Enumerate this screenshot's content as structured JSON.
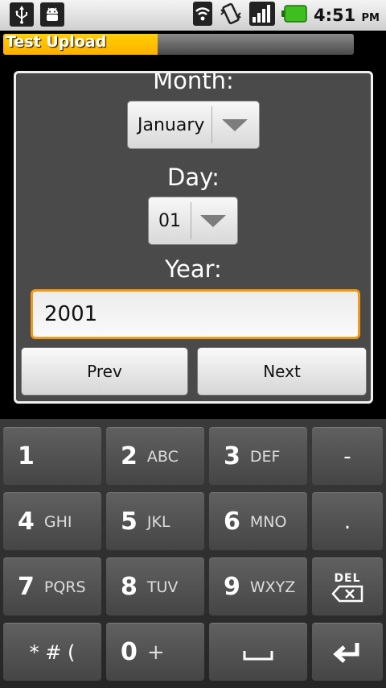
{
  "status_bar": {
    "icons": [
      "usb-icon",
      "android-debug-icon",
      "wifi-icon",
      "vibrate-icon",
      "signal-icon",
      "battery-icon"
    ],
    "time": "4:51",
    "ampm": "PM"
  },
  "title_bar": {
    "title": "Test Upload",
    "progress": 0.44,
    "accent": "#ffc000"
  },
  "form": {
    "month_label": "Month:",
    "month_value": "January",
    "day_label": "Day:",
    "day_value": "01",
    "year_label": "Year:",
    "year_value": "2001",
    "prev_label": "Prev",
    "next_label": "Next",
    "focus_color": "#f29a15"
  },
  "keypad": {
    "keys": [
      {
        "num": "1",
        "letters": ""
      },
      {
        "num": "2",
        "letters": "ABC"
      },
      {
        "num": "3",
        "letters": "DEF"
      },
      {
        "num": "",
        "letters": "-"
      },
      {
        "num": "4",
        "letters": "GHI"
      },
      {
        "num": "5",
        "letters": "JKL"
      },
      {
        "num": "6",
        "letters": "MNO"
      },
      {
        "num": "",
        "letters": "."
      },
      {
        "num": "7",
        "letters": "PQRS"
      },
      {
        "num": "8",
        "letters": "TUV"
      },
      {
        "num": "9",
        "letters": "WXYZ"
      },
      {
        "num": "",
        "letters": "DEL"
      },
      {
        "num": "",
        "letters": "* # ("
      },
      {
        "num": "0",
        "letters": "+"
      },
      {
        "num": "",
        "letters": "space"
      },
      {
        "num": "",
        "letters": "enter"
      }
    ]
  }
}
